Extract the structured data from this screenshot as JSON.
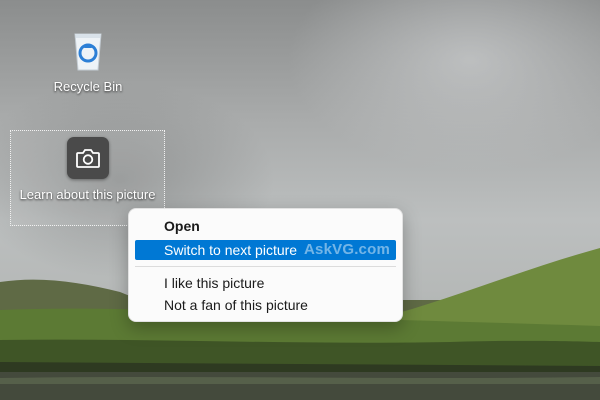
{
  "desktop": {
    "icons": [
      {
        "label": "Recycle Bin",
        "icon": "recycle-bin-icon"
      },
      {
        "label": "Learn about this picture",
        "icon": "camera-icon"
      }
    ]
  },
  "context_menu": {
    "items": [
      {
        "label": "Open",
        "bold": true
      },
      {
        "label": "Switch to next picture",
        "highlighted": true
      },
      {
        "label": "I like this picture"
      },
      {
        "label": "Not a fan of this picture"
      }
    ],
    "highlight_color": "#0078d4"
  },
  "watermark": "AskVG.com"
}
